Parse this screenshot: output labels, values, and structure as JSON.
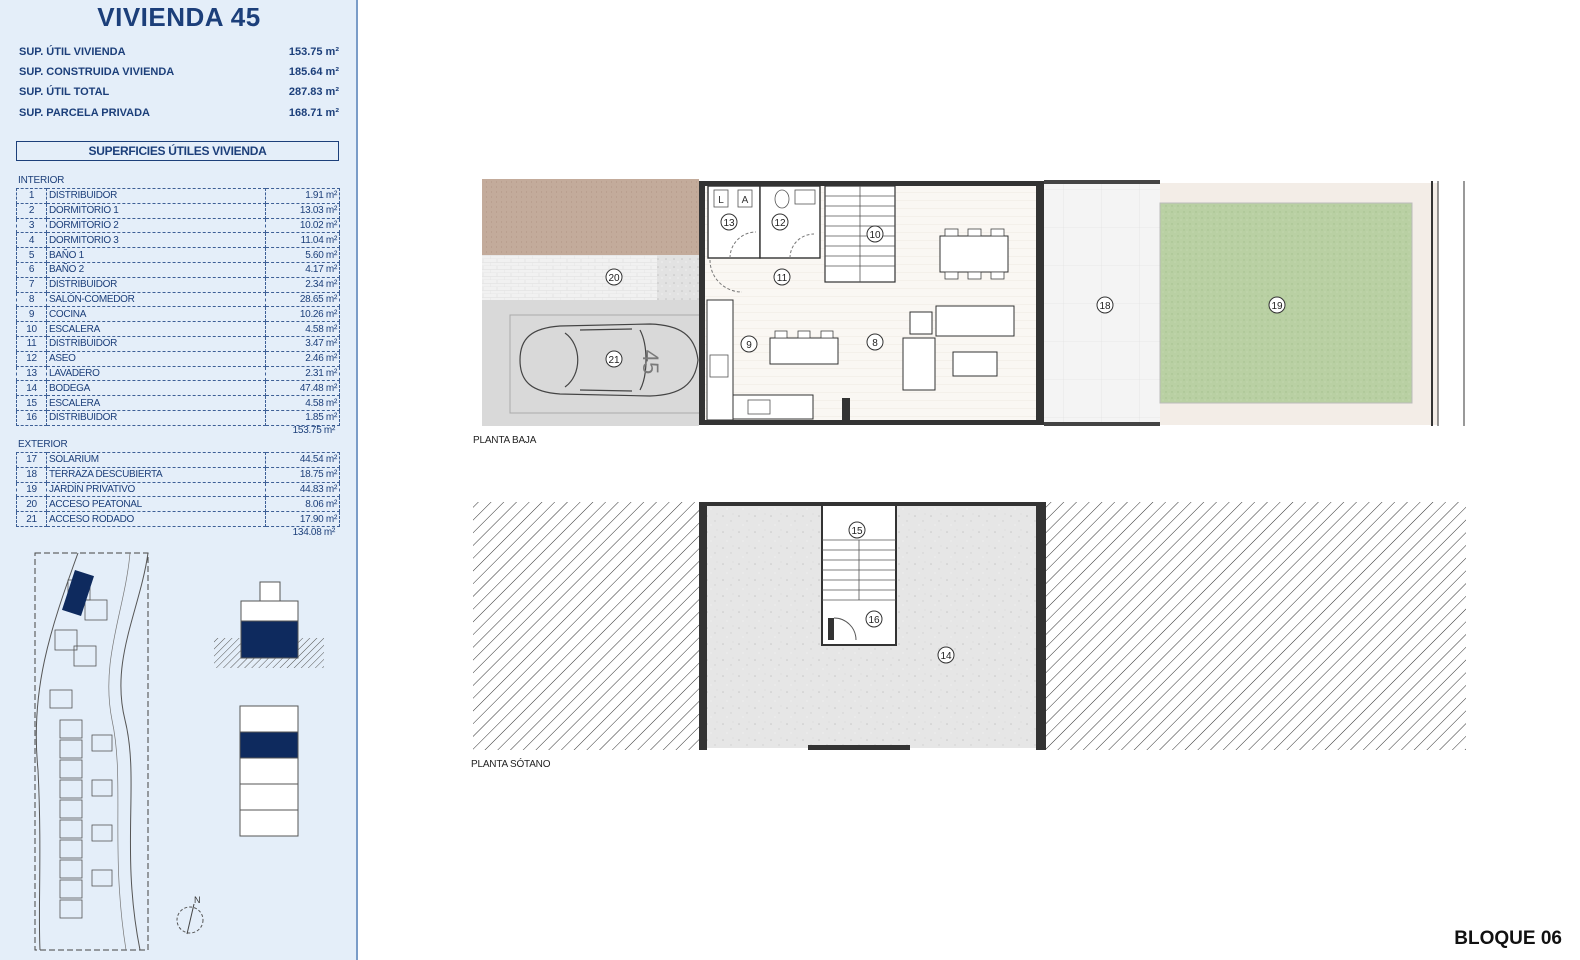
{
  "title": "VIVIENDA 45",
  "summary": [
    {
      "label": "SUP. ÚTIL VIVIENDA",
      "value": "153.75 m²"
    },
    {
      "label": "SUP. CONSTRUIDA VIVIENDA",
      "value": "185.64 m²"
    },
    {
      "label": "SUP. ÚTIL TOTAL",
      "value": "287.83 m²"
    },
    {
      "label": "SUP. PARCELA PRIVADA",
      "value": "168.71 m²"
    }
  ],
  "section_title": "SUPERFICIES ÚTILES VIVIENDA",
  "interior": {
    "label": "INTERIOR",
    "rows": [
      {
        "n": "1",
        "name": "DISTRIBUIDOR",
        "area": "1.91 m²"
      },
      {
        "n": "2",
        "name": "DORMITORIO 1",
        "area": "13.03 m²"
      },
      {
        "n": "3",
        "name": "DORMITORIO 2",
        "area": "10.02 m²"
      },
      {
        "n": "4",
        "name": "DORMITORIO 3",
        "area": "11.04 m²"
      },
      {
        "n": "5",
        "name": "BAÑO 1",
        "area": "5.60 m²"
      },
      {
        "n": "6",
        "name": "BAÑO 2",
        "area": "4.17 m²"
      },
      {
        "n": "7",
        "name": "DISTRIBUIDOR",
        "area": "2.34 m²"
      },
      {
        "n": "8",
        "name": "SALÓN-COMEDOR",
        "area": "28.65 m²"
      },
      {
        "n": "9",
        "name": "COCINA",
        "area": "10.26 m²"
      },
      {
        "n": "10",
        "name": "ESCALERA",
        "area": "4.58 m²"
      },
      {
        "n": "11",
        "name": "DISTRIBUIDOR",
        "area": "3.47 m²"
      },
      {
        "n": "12",
        "name": "ASEO",
        "area": "2.46 m²"
      },
      {
        "n": "13",
        "name": "LAVADERO",
        "area": "2.31 m²"
      },
      {
        "n": "14",
        "name": "BODEGA",
        "area": "47.48 m²"
      },
      {
        "n": "15",
        "name": "ESCALERA",
        "area": "4.58 m²"
      },
      {
        "n": "16",
        "name": "DISTRIBUIDOR",
        "area": "1.85 m²"
      }
    ],
    "total": "153.75 m²"
  },
  "exterior": {
    "label": "EXTERIOR",
    "rows": [
      {
        "n": "17",
        "name": "SOLARIUM",
        "area": "44.54 m²"
      },
      {
        "n": "18",
        "name": "TERRAZA DESCUBIERTA",
        "area": "18.75 m²"
      },
      {
        "n": "19",
        "name": "JARDÍN PRIVATIVO",
        "area": "44.83 m²"
      },
      {
        "n": "20",
        "name": "ACCESO PEATONAL",
        "area": "8.06 m²"
      },
      {
        "n": "21",
        "name": "ACCESO RODADO",
        "area": "17.90 m²"
      }
    ],
    "total": "134.08 m²"
  },
  "compass_label": "N",
  "plan_upper": {
    "caption": "PLANTA BAJA",
    "room_tags": [
      "8",
      "9",
      "10",
      "11",
      "12",
      "13",
      "18",
      "19",
      "20",
      "21"
    ],
    "laundry_letters": [
      "L",
      "A"
    ],
    "car_number": "45"
  },
  "plan_lower": {
    "caption": "PLANTA SÓTANO",
    "room_tags": [
      "14",
      "15",
      "16"
    ]
  },
  "block_label": "BLOQUE 06",
  "colors": {
    "brand": "#1c3f7a",
    "panel_bg": "#e4eef9",
    "highlight": "#0e2a5e",
    "garden": "#b7cfa0",
    "paving": "#c2ab9c"
  }
}
